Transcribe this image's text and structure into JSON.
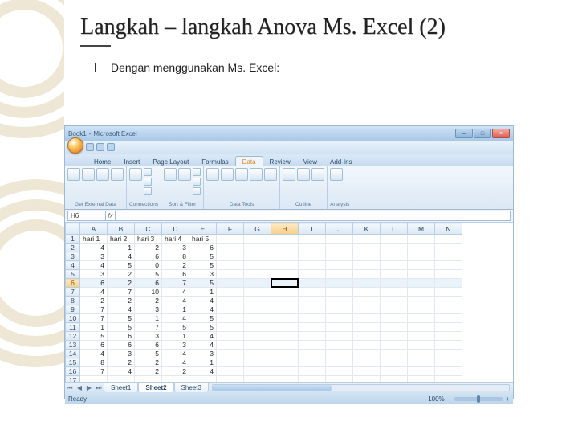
{
  "slide": {
    "title": "Langkah – langkah Anova Ms. Excel (2)",
    "bullet_text": "Dengan menggunakan Ms. Excel:"
  },
  "excel": {
    "titlebar": {
      "doc": "Book1",
      "app": "Microsoft Excel"
    },
    "tabs": [
      "Home",
      "Insert",
      "Page Layout",
      "Formulas",
      "Data",
      "Review",
      "View",
      "Add-Ins"
    ],
    "active_tab_index": 4,
    "ribbon_groups": [
      "Get External Data",
      "Connections",
      "Sort & Filter",
      "Data Tools",
      "Outline",
      "Analysis"
    ],
    "namebox": "H6",
    "columns": [
      "",
      "A",
      "B",
      "C",
      "D",
      "E",
      "F",
      "G",
      "H",
      "I",
      "J",
      "K",
      "L",
      "M",
      "N"
    ],
    "headers_row": [
      "hari 1",
      "hari 2",
      "hari 3",
      "hari 4",
      "hari 5"
    ],
    "data_rows": [
      [
        4,
        1,
        2,
        3,
        6
      ],
      [
        3,
        4,
        6,
        8,
        5
      ],
      [
        4,
        5,
        0,
        2,
        5
      ],
      [
        3,
        2,
        5,
        6,
        3
      ],
      [
        6,
        2,
        6,
        7,
        5
      ],
      [
        4,
        7,
        10,
        4,
        1
      ],
      [
        2,
        2,
        2,
        4,
        4
      ],
      [
        7,
        4,
        3,
        1,
        4
      ],
      [
        7,
        5,
        1,
        4,
        5
      ],
      [
        1,
        5,
        7,
        5,
        5
      ],
      [
        5,
        6,
        3,
        1,
        4
      ],
      [
        6,
        6,
        6,
        3,
        4
      ],
      [
        4,
        3,
        5,
        4,
        3
      ],
      [
        8,
        2,
        2,
        4,
        1
      ],
      [
        7,
        4,
        2,
        2,
        4
      ]
    ],
    "selected_row_index": 6,
    "active_cell": {
      "col_index": 8,
      "row_index": 6
    },
    "sheet_tabs": [
      "Sheet1",
      "Sheet2",
      "Sheet3"
    ],
    "active_sheet_index": 1,
    "status": "Ready",
    "zoom": "100%"
  }
}
